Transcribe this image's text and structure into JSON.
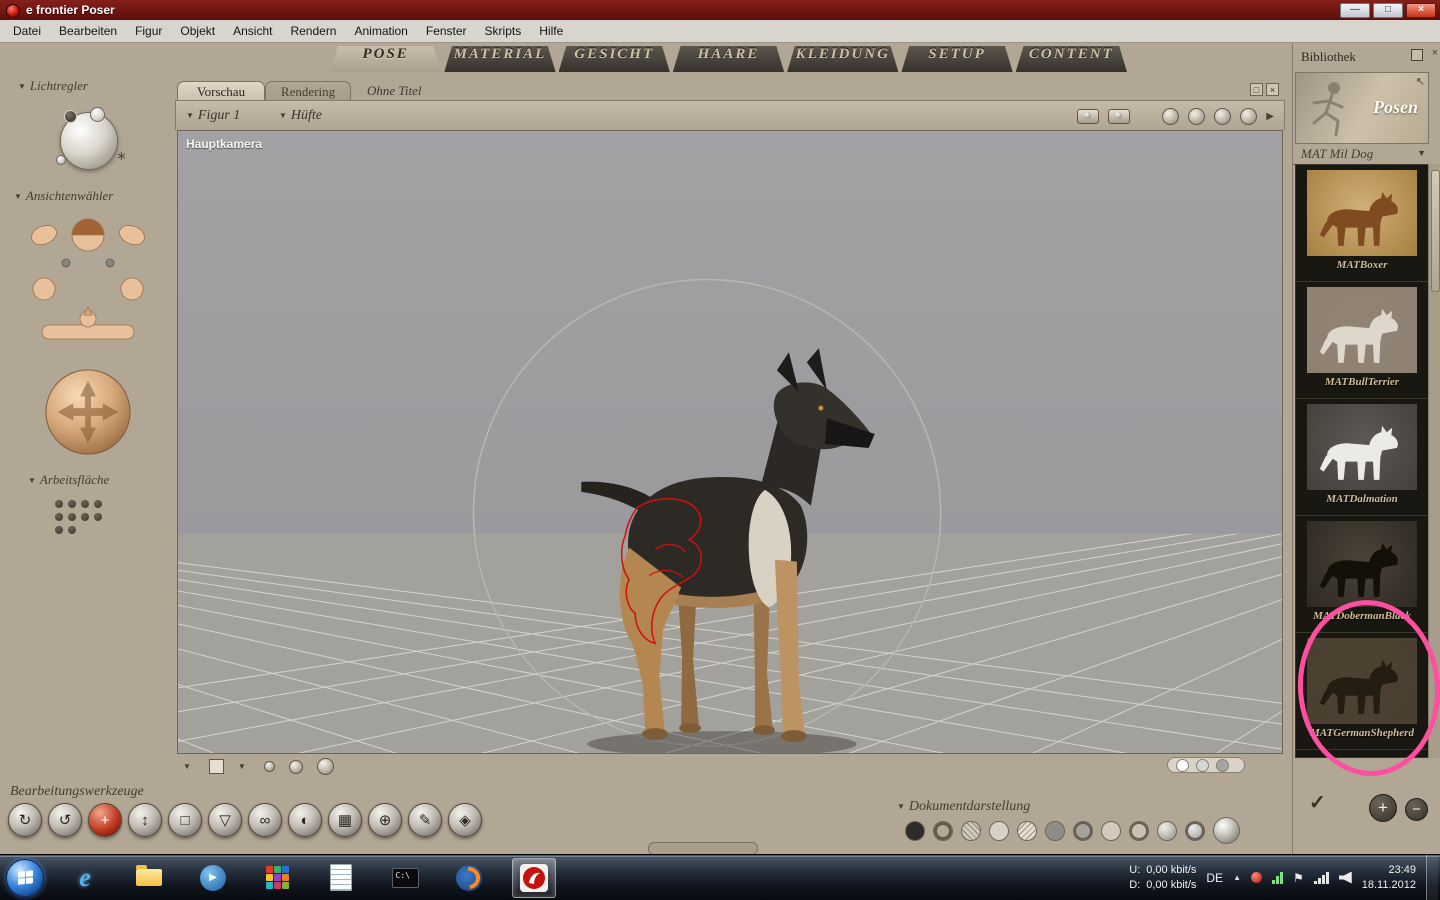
{
  "colors": {
    "titlebar_red": "#6e1210",
    "app_background": "#b2a695",
    "annotation_pink": "#ff4fa0",
    "selection_outline_red": "#d01010",
    "active_tool_red": "#c03a22"
  },
  "icons": {
    "minimize": "—",
    "maximize": "□",
    "close": "×",
    "arrow_down": "▼",
    "arrow_right": "▶",
    "up_left_arrow": "↖",
    "check": "✓",
    "plus": "+",
    "minus": "−",
    "star": "∗",
    "flag": "⚑",
    "hidden_icons": "▲",
    "ie_letter": "e",
    "play": "▶"
  },
  "window": {
    "title": "e frontier Poser"
  },
  "menu": {
    "items": [
      "Datei",
      "Bearbeiten",
      "Figur",
      "Objekt",
      "Ansicht",
      "Rendern",
      "Animation",
      "Fenster",
      "Skripts",
      "Hilfe"
    ]
  },
  "rooms": {
    "tabs": [
      "POSE",
      "MATERIAL",
      "GESICHT",
      "HAARE",
      "KLEIDUNG",
      "SETUP",
      "CONTENT"
    ],
    "active": "POSE"
  },
  "left_panel": {
    "lights_label": "Lichtregler",
    "cameras_label": "Ansichtenwähler",
    "workspace_label": "Arbeitsfläche"
  },
  "document": {
    "tab_preview": "Vorschau",
    "tab_render": "Rendering",
    "title": "Ohne Titel",
    "figure": "Figur 1",
    "actor": "Hüfte",
    "camera": "Hauptkamera"
  },
  "tools": {
    "label": "Bearbeitungswerkzeuge",
    "items": [
      {
        "name": "rotate",
        "glyph": "↻"
      },
      {
        "name": "twist",
        "glyph": "↺"
      },
      {
        "name": "translate",
        "glyph": "+",
        "active": true
      },
      {
        "name": "translate-in-out",
        "glyph": "↕"
      },
      {
        "name": "scale",
        "glyph": "□"
      },
      {
        "name": "taper",
        "glyph": "▽"
      },
      {
        "name": "chain-break",
        "glyph": "∞"
      },
      {
        "name": "color",
        "glyph": "◐"
      },
      {
        "name": "grouping",
        "glyph": "▦"
      },
      {
        "name": "view-magnifier",
        "glyph": "⊕"
      },
      {
        "name": "morph",
        "glyph": "✎"
      },
      {
        "name": "direct-manipulation",
        "glyph": "◈"
      }
    ]
  },
  "display": {
    "label": "Dokumentdarstellung",
    "styles": [
      "silhouette",
      "outline",
      "wireframe",
      "hidden-line",
      "lit-wireframe",
      "flat-shaded",
      "flat-lined",
      "cartoon",
      "cartoon-lined",
      "smooth-shaded",
      "smooth-lined",
      "texture-shaded"
    ]
  },
  "library": {
    "title": "Bibliothek",
    "category": "Posen",
    "folder": "MAT Mil Dog",
    "items": [
      {
        "label": "MATBoxer"
      },
      {
        "label": "MATBullTerrier"
      },
      {
        "label": "MATDalmation"
      },
      {
        "label": "MATDobermanBlack"
      },
      {
        "label": "MATGermanShepherd",
        "highlighted": true
      }
    ]
  },
  "taskbar": {
    "apps": [
      "start",
      "internet-explorer",
      "windows-explorer",
      "media-player",
      "game",
      "notepad",
      "command-prompt",
      "firefox",
      "poser"
    ],
    "cmd_text": "C:\\",
    "tray": {
      "upload_label": "U:",
      "upload_value": "0,00 kbit/s",
      "download_label": "D:",
      "download_value": "0,00 kbit/s",
      "language": "DE",
      "time": "23:49",
      "date": "18.11.2012"
    }
  }
}
